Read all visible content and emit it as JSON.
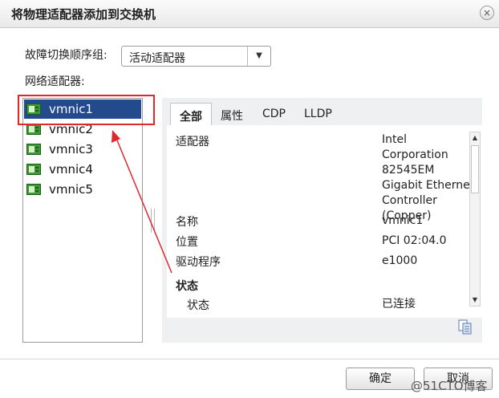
{
  "dialog": {
    "title": "将物理适配器添加到交换机",
    "close_glyph": "×"
  },
  "failover": {
    "label": "故障切换顺序组:",
    "selected": "活动适配器",
    "arrow_glyph": "▼"
  },
  "adapters": {
    "label": "网络适配器:",
    "items": [
      {
        "label": "vmnic1",
        "selected": true
      },
      {
        "label": "vmnic2",
        "selected": false
      },
      {
        "label": "vmnic3",
        "selected": false
      },
      {
        "label": "vmnic4",
        "selected": false
      },
      {
        "label": "vmnic5",
        "selected": false
      }
    ]
  },
  "details": {
    "tabs": [
      {
        "label": "全部",
        "active": true
      },
      {
        "label": "属性",
        "active": false
      },
      {
        "label": "CDP",
        "active": false
      },
      {
        "label": "LLDP",
        "active": false
      }
    ],
    "rows": [
      {
        "label": "适配器",
        "value_lines": [
          "Intel Corporation",
          "82545EM",
          "Gigabit Ethernet",
          "Controller",
          "(Copper)"
        ]
      },
      {
        "label": "名称",
        "value": "vmnic1"
      },
      {
        "label": "位置",
        "value": "PCI 02:04.0"
      },
      {
        "label": "驱动程序",
        "value": "e1000"
      }
    ],
    "section_status": "状态",
    "status_row": {
      "label": "状态",
      "value": "已连接"
    },
    "scroll_up": "▲",
    "scroll_down": "▼"
  },
  "footer": {
    "ok_label": "确定",
    "cancel_label": "取消"
  },
  "watermark": "@51CTO博客",
  "colors": {
    "selection": "#244a8e",
    "highlight": "#e0282c",
    "nic_icon": "#3c9a34"
  }
}
